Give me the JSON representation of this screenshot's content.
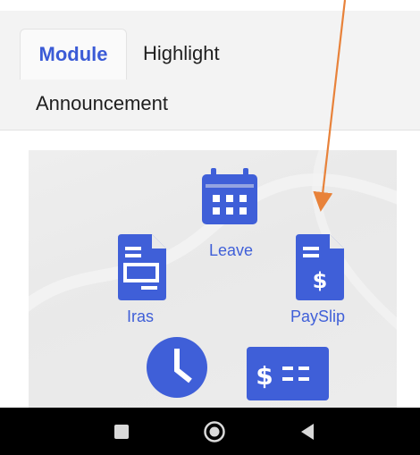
{
  "tabs": {
    "module": "Module",
    "highlight": "Highlight",
    "announcement": "Announcement"
  },
  "modules": {
    "leave": "Leave",
    "iras": "Iras",
    "payslip": "PaySlip"
  },
  "colors": {
    "accent": "#3f5fd8",
    "icon": "#3f5fd8",
    "annotation_arrow": "#e8823a",
    "nav_background": "#000000"
  },
  "navbar": {
    "recent_icon": "square-icon",
    "home_icon": "circle-icon",
    "back_icon": "triangle-back-icon"
  }
}
